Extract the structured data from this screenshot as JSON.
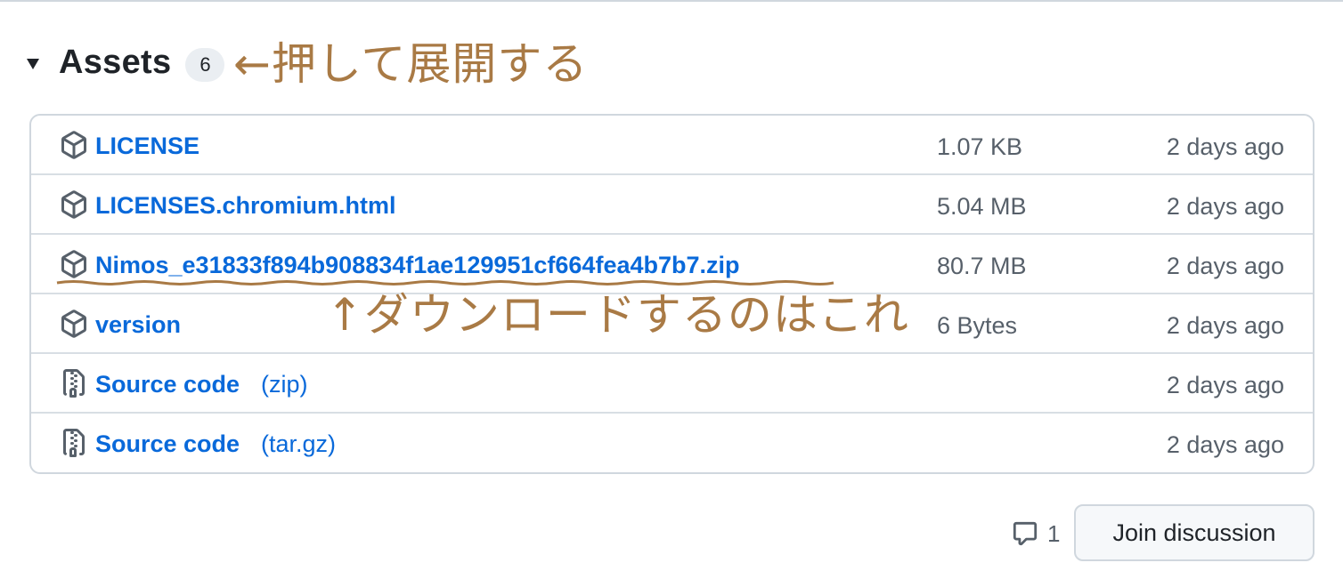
{
  "assets": {
    "title": "Assets",
    "count": "6",
    "annotation": "←押して展開する",
    "rows": [
      {
        "icon": "package-icon",
        "name": "LICENSE",
        "suffix": "",
        "size": "1.07 KB",
        "date": "2 days ago"
      },
      {
        "icon": "package-icon",
        "name": "LICENSES.chromium.html",
        "suffix": "",
        "size": "5.04 MB",
        "date": "2 days ago"
      },
      {
        "icon": "package-icon",
        "name": "Nimos_e31833f894b908834f1ae129951cf664fea4b7b7.zip",
        "suffix": "",
        "size": "80.7 MB",
        "date": "2 days ago"
      },
      {
        "icon": "package-icon",
        "name": "version",
        "suffix": "",
        "size": "6 Bytes",
        "date": "2 days ago"
      },
      {
        "icon": "file-zip-icon",
        "name": "Source code",
        "suffix": "(zip)",
        "size": "",
        "date": "2 days ago"
      },
      {
        "icon": "file-zip-icon",
        "name": "Source code",
        "suffix": "(tar.gz)",
        "size": "",
        "date": "2 days ago"
      }
    ],
    "download_annotation": "↑ダウンロードするのはこれ"
  },
  "footer": {
    "comment_count": "1",
    "join_label": "Join discussion"
  },
  "colors": {
    "link": "#0969da",
    "muted": "#57606a",
    "border": "#d0d7de",
    "annotation": "#a97a45"
  }
}
